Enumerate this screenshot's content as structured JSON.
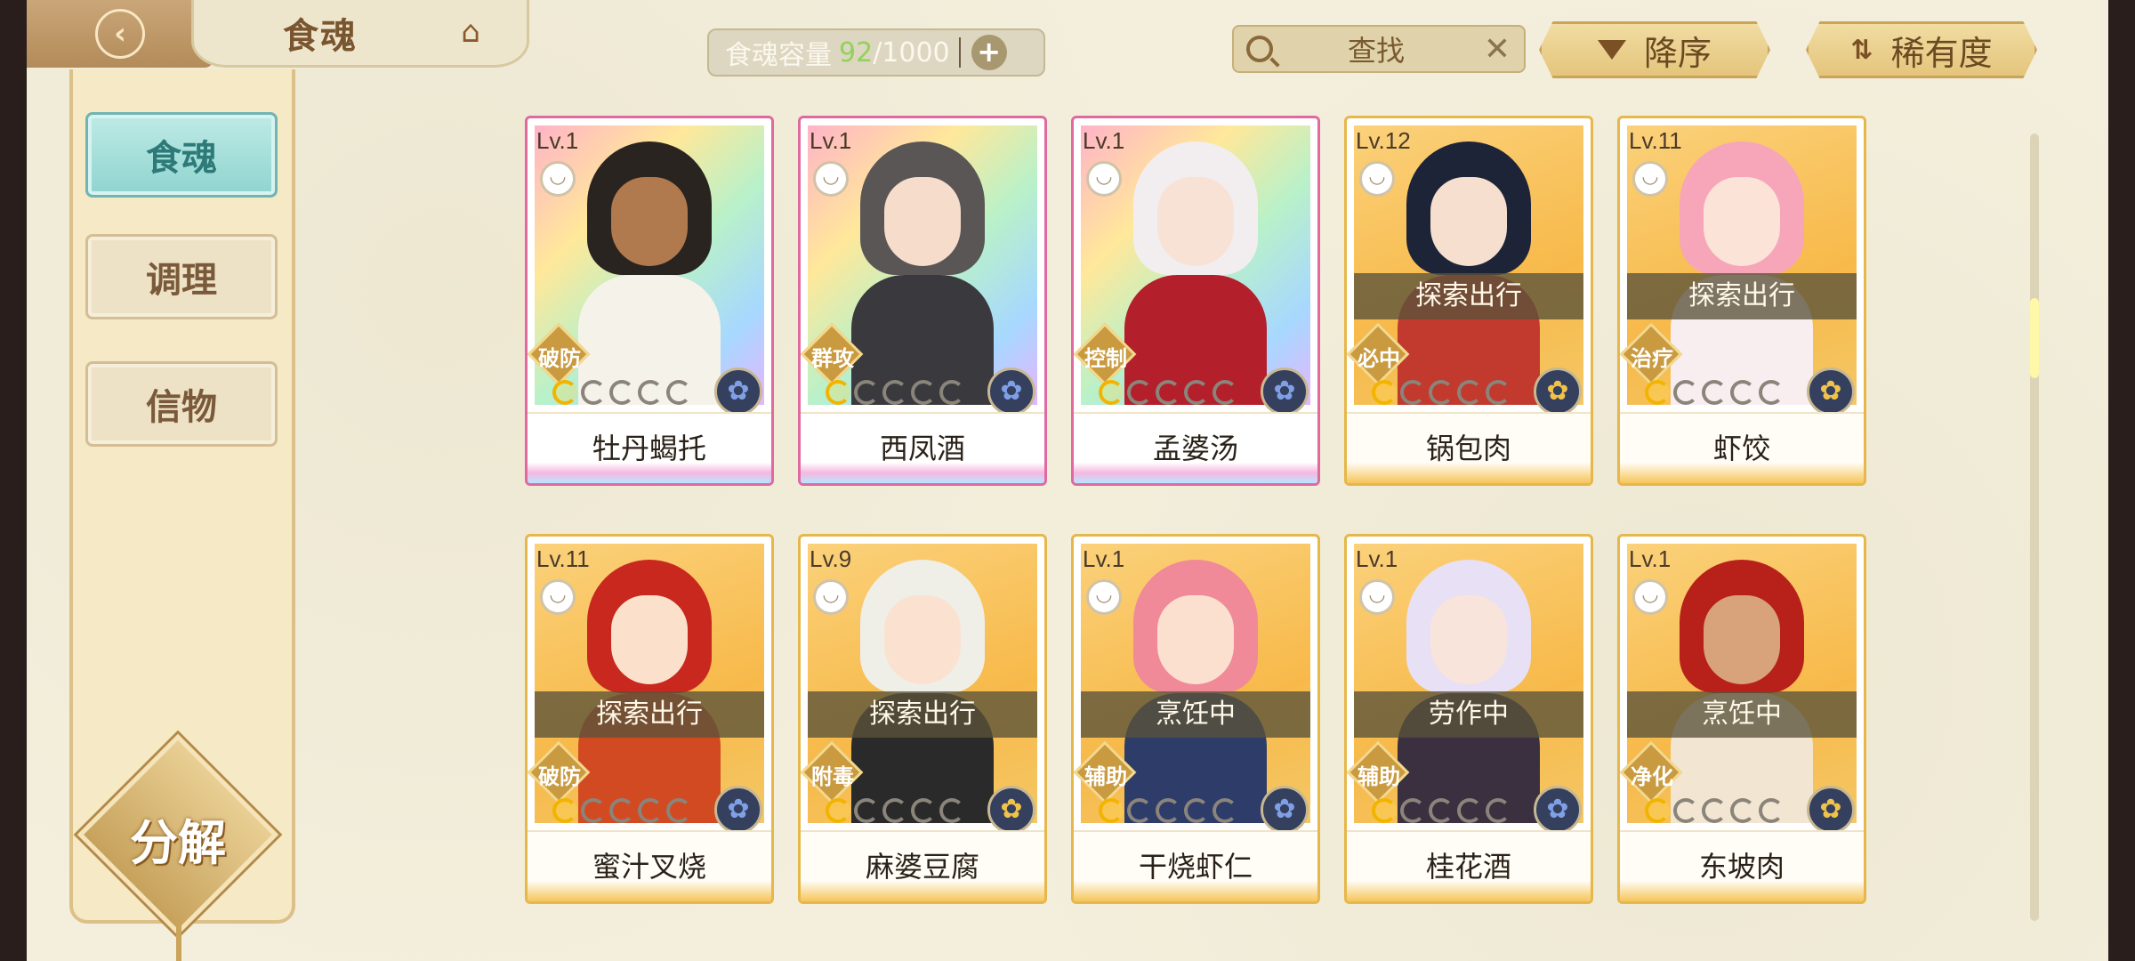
{
  "header": {
    "title": "食魂",
    "capacity_label": "食魂容量",
    "capacity_count": "92",
    "capacity_max": "/1000",
    "search_label": "查找",
    "sort_order_label": "降序",
    "sort_by_label": "稀有度"
  },
  "sidebar": {
    "items": [
      {
        "label": "食魂",
        "active": true
      },
      {
        "label": "调理",
        "active": false
      },
      {
        "label": "信物",
        "active": false
      }
    ],
    "decompose_label": "分解"
  },
  "cards": [
    {
      "level": "Lv.1",
      "name": "牡丹蝎托",
      "role": "破防",
      "status": "",
      "stars_lit": 1,
      "frame": "rainbow",
      "hair": "#2a2420",
      "face": "#b07a4e",
      "body": "#f5f2ea",
      "element": "blue"
    },
    {
      "level": "Lv.1",
      "name": "西凤酒",
      "role": "群攻",
      "status": "",
      "stars_lit": 1,
      "frame": "rainbow",
      "hair": "#5a5656",
      "face": "#f6dccb",
      "body": "#3a3a3e",
      "element": "blue"
    },
    {
      "level": "Lv.1",
      "name": "孟婆汤",
      "role": "控制",
      "status": "",
      "stars_lit": 1,
      "frame": "rainbow",
      "hair": "#f2eef0",
      "face": "#f8e2d6",
      "body": "#b3202c",
      "element": "blue"
    },
    {
      "level": "Lv.12",
      "name": "锅包肉",
      "role": "必中",
      "status": "探索出行",
      "stars_lit": 1,
      "frame": "gold",
      "hair": "#1e2438",
      "face": "#f7dfcf",
      "body": "#c23a2e",
      "element": "gold"
    },
    {
      "level": "Lv.11",
      "name": "虾饺",
      "role": "治疗",
      "status": "探索出行",
      "stars_lit": 1,
      "frame": "gold",
      "hair": "#f6a6b8",
      "face": "#fbe3d8",
      "body": "#f8eef0",
      "element": "gold"
    },
    {
      "level": "Lv.11",
      "name": "蜜汁叉烧",
      "role": "破防",
      "status": "探索出行",
      "stars_lit": 1,
      "frame": "gold",
      "hair": "#c8281e",
      "face": "#fbe0cc",
      "body": "#d24a22",
      "element": "blue"
    },
    {
      "level": "Lv.9",
      "name": "麻婆豆腐",
      "role": "附毒",
      "status": "探索出行",
      "stars_lit": 1,
      "frame": "gold",
      "hair": "#efefe8",
      "face": "#fbe2d0",
      "body": "#2a2a2a",
      "element": "gold"
    },
    {
      "level": "Lv.1",
      "name": "干烧虾仁",
      "role": "辅助",
      "status": "烹饪中",
      "stars_lit": 1,
      "frame": "gold",
      "hair": "#f08a98",
      "face": "#fbe0d0",
      "body": "#2e3c6a",
      "element": "blue"
    },
    {
      "level": "Lv.1",
      "name": "桂花酒",
      "role": "辅助",
      "status": "劳作中",
      "stars_lit": 1,
      "frame": "gold",
      "hair": "#e8e0f4",
      "face": "#f8e4da",
      "body": "#3a3040",
      "element": "blue"
    },
    {
      "level": "Lv.1",
      "name": "东坡肉",
      "role": "净化",
      "status": "烹饪中",
      "stars_lit": 1,
      "frame": "gold",
      "hair": "#b8201a",
      "face": "#d8a27a",
      "body": "#f2e6d2",
      "element": "gold"
    }
  ]
}
